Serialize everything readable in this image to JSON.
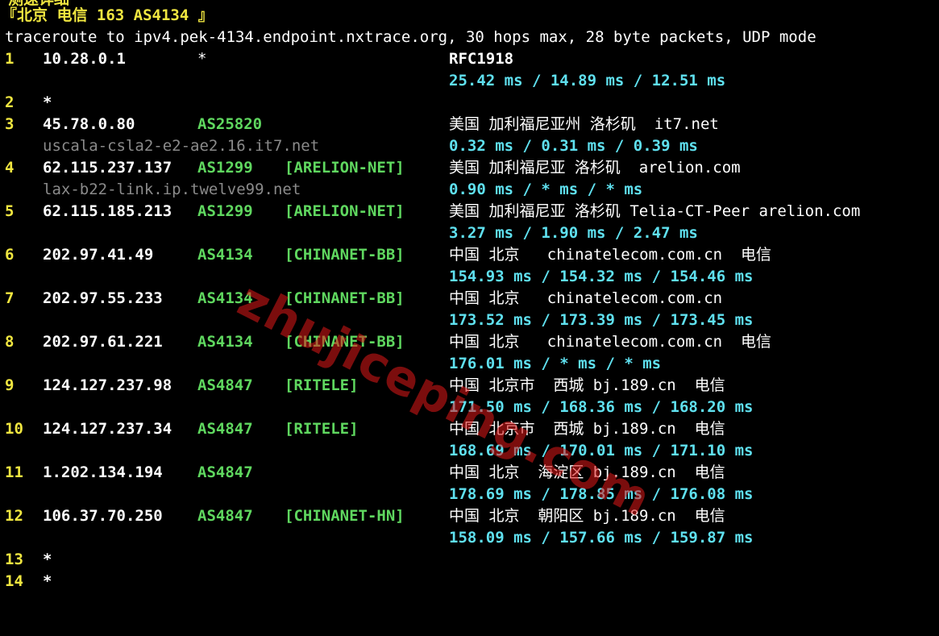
{
  "cut_header": "测速详细",
  "title": "『北京 电信 163 AS4134 』",
  "header": "traceroute to ipv4.pek-4134.endpoint.nxtrace.org, 30 hops max, 28 byte packets, UDP mode",
  "hops": [
    {
      "num": "1",
      "ip": "10.28.0.1",
      "asn": "*",
      "net": "",
      "geo": "RFC1918",
      "host": "",
      "rtt": "25.42 ms / 14.89 ms / 12.51 ms"
    },
    {
      "num": "2",
      "ip": "*"
    },
    {
      "num": "3",
      "ip": "45.78.0.80",
      "asn": "AS25820",
      "net": "",
      "geo": "美国 加利福尼亚州 洛杉矶  it7.net",
      "host": "uscala-csla2-e2-ae2.16.it7.net",
      "rtt": "0.32 ms / 0.31 ms / 0.39 ms"
    },
    {
      "num": "4",
      "ip": "62.115.237.137",
      "asn": "AS1299",
      "net": "[ARELION-NET]",
      "geo": "美国 加利福尼亚 洛杉矶  arelion.com",
      "host": "lax-b22-link.ip.twelve99.net",
      "rtt": "0.90 ms / * ms / * ms"
    },
    {
      "num": "5",
      "ip": "62.115.185.213",
      "asn": "AS1299",
      "net": "[ARELION-NET]",
      "geo": "美国 加利福尼亚 洛杉矶 Telia-CT-Peer arelion.com",
      "host": "",
      "rtt": "3.27 ms / 1.90 ms / 2.47 ms"
    },
    {
      "num": "6",
      "ip": "202.97.41.49",
      "asn": "AS4134",
      "net": "[CHINANET-BB]",
      "geo": "中国 北京   chinatelecom.com.cn  电信",
      "host": "",
      "rtt": "154.93 ms / 154.32 ms / 154.46 ms"
    },
    {
      "num": "7",
      "ip": "202.97.55.233",
      "asn": "AS4134",
      "net": "[CHINANET-BB]",
      "geo": "中国 北京   chinatelecom.com.cn",
      "host": "",
      "rtt": "173.52 ms / 173.39 ms / 173.45 ms"
    },
    {
      "num": "8",
      "ip": "202.97.61.221",
      "asn": "AS4134",
      "net": "[CHINANET-BB]",
      "geo": "中国 北京   chinatelecom.com.cn  电信",
      "host": "",
      "rtt": "176.01 ms / * ms / * ms"
    },
    {
      "num": "9",
      "ip": "124.127.237.98",
      "asn": "AS4847",
      "net": "[RITELE]",
      "geo": "中国 北京市  西城 bj.189.cn  电信",
      "host": "",
      "rtt": "171.50 ms / 168.36 ms / 168.20 ms"
    },
    {
      "num": "10",
      "ip": "124.127.237.34",
      "asn": "AS4847",
      "net": "[RITELE]",
      "geo": "中国 北京市  西城 bj.189.cn  电信",
      "host": "",
      "rtt": "168.69 ms / 170.01 ms / 171.10 ms"
    },
    {
      "num": "11",
      "ip": "1.202.134.194",
      "asn": "AS4847",
      "net": "",
      "geo": "中国 北京  海淀区 bj.189.cn  电信",
      "host": "",
      "rtt": "178.69 ms / 178.85 ms / 176.08 ms"
    },
    {
      "num": "12",
      "ip": "106.37.70.250",
      "asn": "AS4847",
      "net": "[CHINANET-HN]",
      "geo": "中国 北京  朝阳区 bj.189.cn  电信",
      "host": "",
      "rtt": "158.09 ms / 157.66 ms / 159.87 ms"
    },
    {
      "num": "13",
      "ip": "*"
    },
    {
      "num": "14",
      "ip": "*"
    }
  ],
  "watermark": "zhujiceping.com",
  "colors": {
    "background": "#000000",
    "hop_number": "#f0e640",
    "asn": "#5fd75f",
    "rtt": "#5fe0ef",
    "hostname": "#8a8a8a",
    "watermark": "#e01818"
  }
}
